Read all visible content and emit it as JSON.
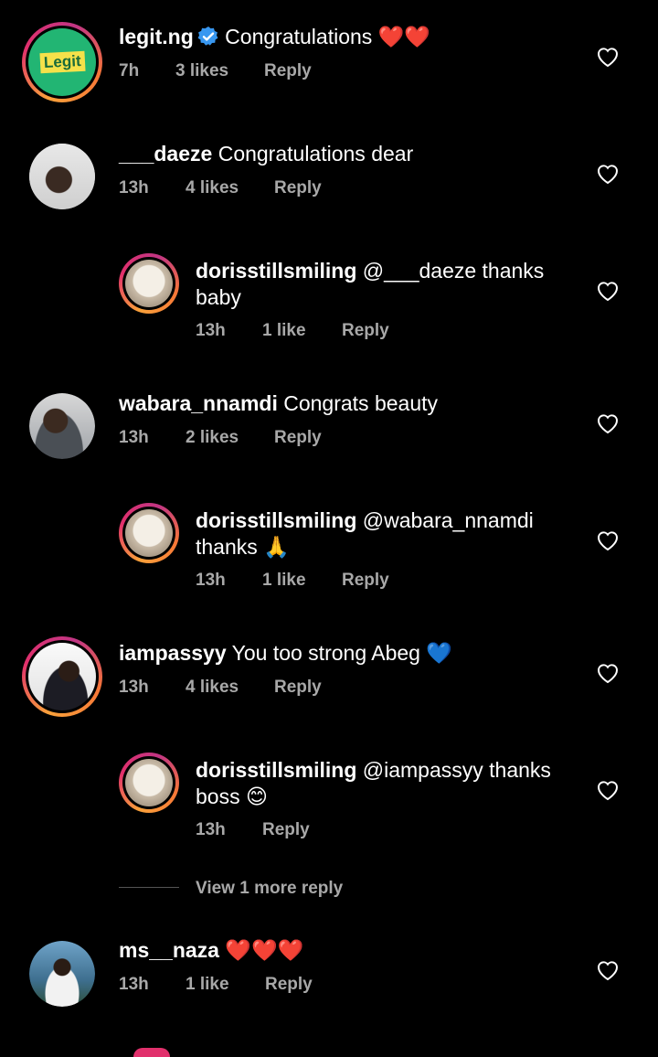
{
  "comments": [
    {
      "user": "legit.ng",
      "text": " Congratulations ❤️❤️",
      "time": "7h",
      "likes": "3 likes",
      "reply": "Reply"
    },
    {
      "user": "___daeze",
      "text": " Congratulations dear",
      "time": "13h",
      "likes": "4 likes",
      "reply": "Reply"
    },
    {
      "user": "dorisstillsmiling",
      "text": " @___daeze thanks",
      "text2": "baby",
      "time": "13h",
      "likes": "1 like",
      "reply": "Reply"
    },
    {
      "user": "wabara_nnamdi",
      "text": " Congrats beauty",
      "time": "13h",
      "likes": "2 likes",
      "reply": "Reply"
    },
    {
      "user": "dorisstillsmiling",
      "text": " @wabara_nnamdi",
      "text2": "thanks 🙏",
      "time": "13h",
      "likes": "1 like",
      "reply": "Reply"
    },
    {
      "user": "iampassyy",
      "text": " You too strong Abeg 💙",
      "time": "13h",
      "likes": "4 likes",
      "reply": "Reply"
    },
    {
      "user": "dorisstillsmiling",
      "text": " @iampassyy thanks",
      "text2": "boss 😊",
      "time": "13h",
      "reply": "Reply"
    },
    {
      "user": "ms__naza",
      "text": " ❤️❤️❤️",
      "time": "13h",
      "likes": "1 like",
      "reply": "Reply"
    }
  ],
  "view_more": "View 1 more reply",
  "legit_logo_text": "Legit",
  "colors": {
    "background": "#000000",
    "meta": "#a8a8a8",
    "verified": "#3897f0",
    "legit_green": "#22b573"
  }
}
